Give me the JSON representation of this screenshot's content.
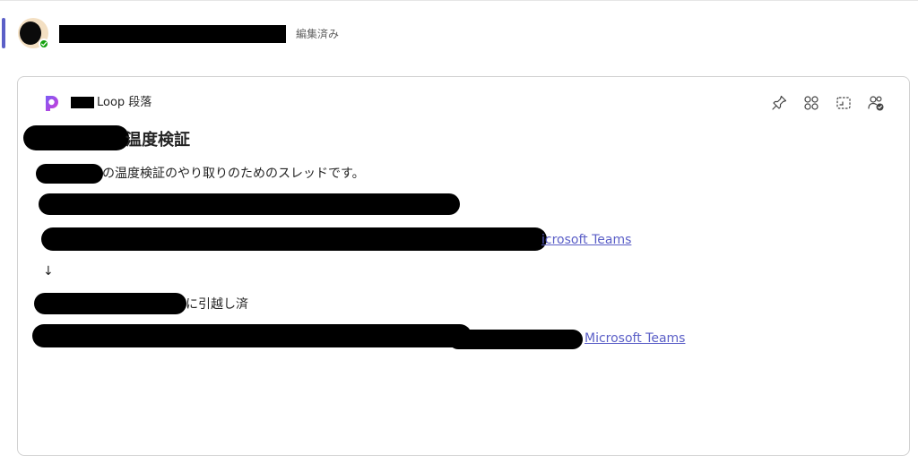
{
  "message": {
    "edited_label": "編集済み"
  },
  "loop": {
    "header_label": "Loop 段落",
    "heading_suffix": "温度検証",
    "line1_suffix": "の温度検証のやり取りのためのスレッドです。",
    "link1_text": "icrosoft Teams",
    "arrow": "↓",
    "moved_suffix": "に引越し済",
    "link2_text": "Microsoft Teams"
  },
  "icons": {
    "presence": "check-icon",
    "loop": "loop-logo-icon",
    "actions": [
      "pin-icon",
      "apps-icon",
      "copy-component-icon",
      "people-settings-icon"
    ]
  },
  "colors": {
    "accent": "#5b5fc7",
    "presence": "#13a10e",
    "link": "#5b5fc7"
  }
}
